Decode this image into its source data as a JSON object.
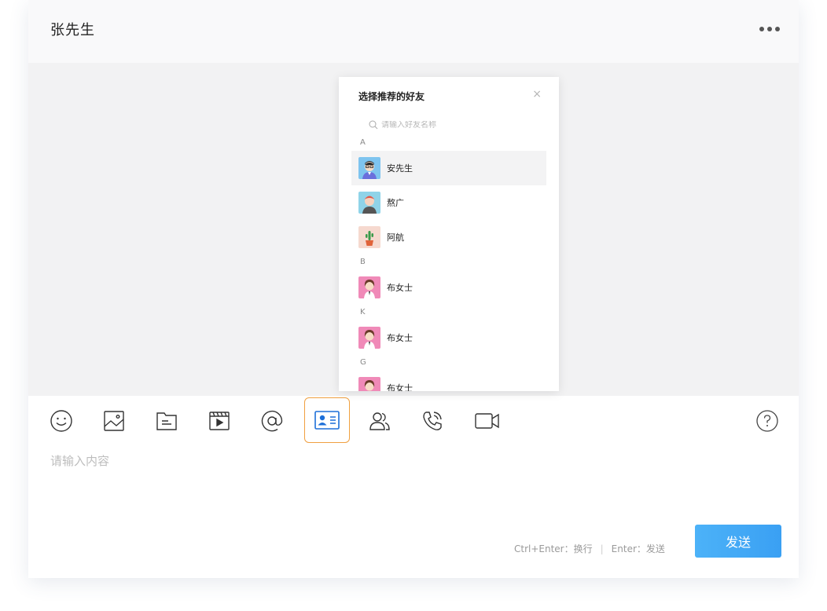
{
  "header": {
    "title": "张先生"
  },
  "popup": {
    "title": "选择推荐的好友",
    "close": "×",
    "search_placeholder": "请输入好友名称",
    "groups": [
      {
        "letter": "A",
        "friends": [
          {
            "name": "安先生",
            "avatar": "boy-glasses-avatar",
            "selected": true
          },
          {
            "name": "熬广",
            "avatar": "boy-red-hair-avatar"
          },
          {
            "name": "阿航",
            "avatar": "cactus-plant-avatar"
          }
        ]
      },
      {
        "letter": "B",
        "friends": [
          {
            "name": "布女士",
            "avatar": "girl-pink-avatar"
          }
        ]
      },
      {
        "letter": "K",
        "friends": [
          {
            "name": "布女士",
            "avatar": "girl-pink-avatar"
          }
        ]
      },
      {
        "letter": "G",
        "friends": [
          {
            "name": "布女士",
            "avatar": "girl-pink-avatar"
          }
        ]
      }
    ]
  },
  "toolbar": {
    "icons": [
      "emoji-icon",
      "image-icon",
      "file-icon",
      "video-clip-icon",
      "mention-icon",
      "contact-card-icon",
      "group-icon",
      "phone-call-icon",
      "video-call-icon"
    ],
    "help_icon": "help-icon",
    "active_icon": "contact-card-icon"
  },
  "composer": {
    "placeholder": "请输入内容",
    "hint_newline": "Ctrl+Enter：换行",
    "hint_sep": "|",
    "hint_send": "Enter：发送",
    "send_label": "发送"
  },
  "colors": {
    "accent": "#3aa0f3",
    "active_border": "#f0a040",
    "contact_card": "#3b82e8"
  }
}
